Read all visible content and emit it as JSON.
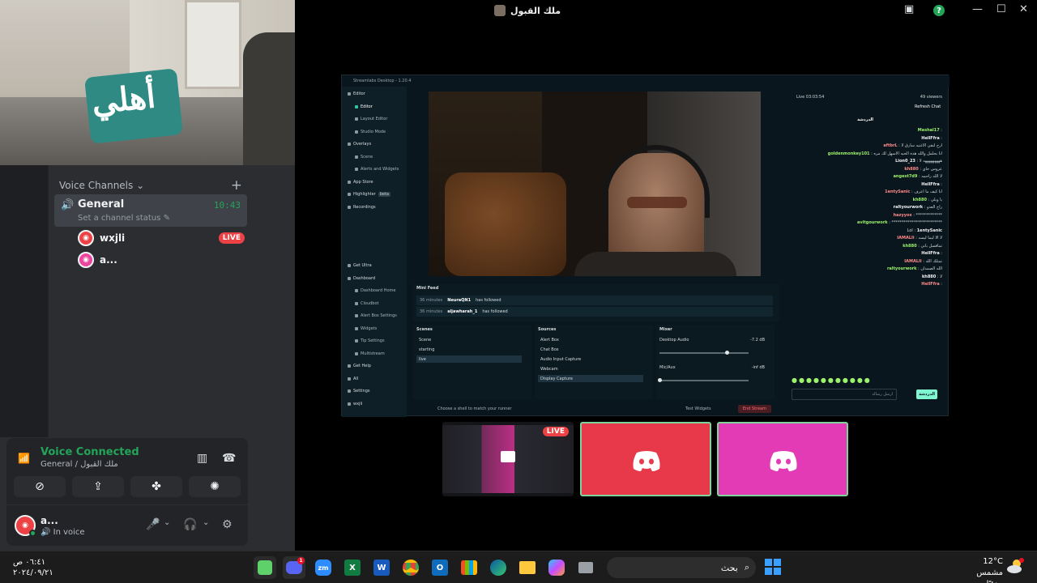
{
  "window": {
    "title": "ملك القبول",
    "controls": [
      "—",
      "☐",
      "✕"
    ]
  },
  "voice_channels": {
    "header": "Voice Channels",
    "channel": {
      "name": "General",
      "time": "10:43",
      "status": "Set a channel status"
    },
    "users": [
      {
        "name": "wxjli",
        "badge": "LIVE"
      },
      {
        "name": "a..."
      }
    ]
  },
  "voice_panel": {
    "status": "Voice Connected",
    "location": "General / ملك القبول"
  },
  "user_bar": {
    "name": "a...",
    "status": "In voice"
  },
  "streamlabs": {
    "app_title": "Streamlabs Desktop - 1.20.4",
    "nav": [
      {
        "label": "Editor",
        "type": "section"
      },
      {
        "label": "Editor",
        "type": "sub",
        "active": true
      },
      {
        "label": "Layout Editor",
        "type": "sub"
      },
      {
        "label": "Studio Mode",
        "type": "sub"
      },
      {
        "label": "Overlays",
        "type": "section"
      },
      {
        "label": "Scene",
        "type": "sub"
      },
      {
        "label": "Alerts and Widgets",
        "type": "sub"
      },
      {
        "label": "App Store",
        "type": "section"
      },
      {
        "label": "Highlighter",
        "type": "section",
        "badge": "beta"
      },
      {
        "label": "Recordings",
        "type": "section"
      },
      {
        "label": "Get Ultra",
        "type": "section"
      },
      {
        "label": "Dashboard",
        "type": "section"
      },
      {
        "label": "Dashboard Home",
        "type": "sub"
      },
      {
        "label": "Cloudbot",
        "type": "sub"
      },
      {
        "label": "Alert Box Settings",
        "type": "sub"
      },
      {
        "label": "Widgets",
        "type": "sub"
      },
      {
        "label": "Tip Settings",
        "type": "sub"
      },
      {
        "label": "Multistream",
        "type": "sub"
      },
      {
        "label": "Get Help",
        "type": "section"
      },
      {
        "label": "All",
        "type": "section"
      },
      {
        "label": "Settings",
        "type": "section"
      },
      {
        "label": "wxjli",
        "type": "section"
      }
    ],
    "mini_feed": {
      "title": "Mini Feed",
      "rows": [
        {
          "time": "36 minutes",
          "user": "NeuraQN1",
          "action": "has followed"
        },
        {
          "time": "36 minutes",
          "user": "aljawharah_1",
          "action": "has followed"
        }
      ]
    },
    "scenes": {
      "title": "Scenes",
      "items": [
        "Scene",
        "starting",
        "live"
      ],
      "selected": 2
    },
    "sources": {
      "title": "Sources",
      "items": [
        "Alert Box",
        "Chat Box",
        "Audio Input Capture",
        "Webcam",
        "Display Capture"
      ],
      "selected": 4
    },
    "mixer": {
      "title": "Mixer",
      "rows": [
        {
          "name": "Desktop Audio",
          "db": "-7.2 dB",
          "level": 0.75
        },
        {
          "name": "Mic/Aux",
          "db": "-inf dB",
          "level": 0.0
        }
      ]
    },
    "bottom_bar": {
      "prompt": "Choose a shell to match your runner",
      "test_widgets": "Test Widgets",
      "end_stream": "End Stream"
    },
    "chat": {
      "live_time": "Live 03:03:54",
      "viewers": "49 viewers",
      "refresh": "Refresh Chat",
      "title": "الدردشة",
      "messages": [
        {
          "user": "Meshal17",
          "text": ""
        },
        {
          "user": "HellFfra",
          "text": ""
        },
        {
          "user": "aftbrL",
          "text": "ارح لنقي الاغنيه سارق لا"
        },
        {
          "user": "goldenmonkey101",
          "text": "انا بحلمل والله هذه الحبه الاسهل لك مره"
        },
        {
          "user": "Lion0_23",
          "text": "هههههههههه لا"
        },
        {
          "user": "kh880",
          "text": "عروس حاي"
        },
        {
          "user": "angest7d9",
          "text": "لا الله زاحمه"
        },
        {
          "user": "HellFfra",
          "text": ""
        },
        {
          "user": "1entySanic",
          "text": "انا كيف ما اعرف"
        },
        {
          "user": "kh880",
          "text": "يا ويلي"
        },
        {
          "user": "raltyourwork",
          "text": "راح العدو"
        },
        {
          "user": "hazyyox",
          "text": "*************"
        },
        {
          "user": "avitgourwork",
          "text": "*************************"
        },
        {
          "user": "1entySanic",
          "text": "Lol"
        },
        {
          "user": "IAMALIi",
          "text": "لا الا ليما ليسه"
        },
        {
          "user": "kh880",
          "text": "تمافسل باني"
        },
        {
          "user": "HellFfra",
          "text": ""
        },
        {
          "user": "IAMALIi",
          "text": "تمتلك الله"
        },
        {
          "user": "raltyourwork",
          "text": "الله الصمدان"
        },
        {
          "user": "kh880",
          "text": "لا"
        },
        {
          "user": "HellFfra",
          "text": ""
        }
      ],
      "input_placeholder": "ارسل رسالة",
      "send_label": "الدردشة"
    }
  },
  "stream_tiles": {
    "live_badge": "LIVE"
  },
  "taskbar": {
    "time": "٠٦:٤١ ص",
    "date": "٢٠٢٤/٠٩/٢١",
    "search_placeholder": "بحث",
    "weather_temp": "12°C",
    "weather_desc": "مشمس جزئيًا",
    "apps": [
      "Camera",
      "Discord",
      "Zoom",
      "Excel",
      "Word",
      "Chrome",
      "Outlook",
      "Store",
      "Edge",
      "File Explorer",
      "Copilot",
      "Snipping Tool"
    ],
    "discord_badge": "1"
  }
}
